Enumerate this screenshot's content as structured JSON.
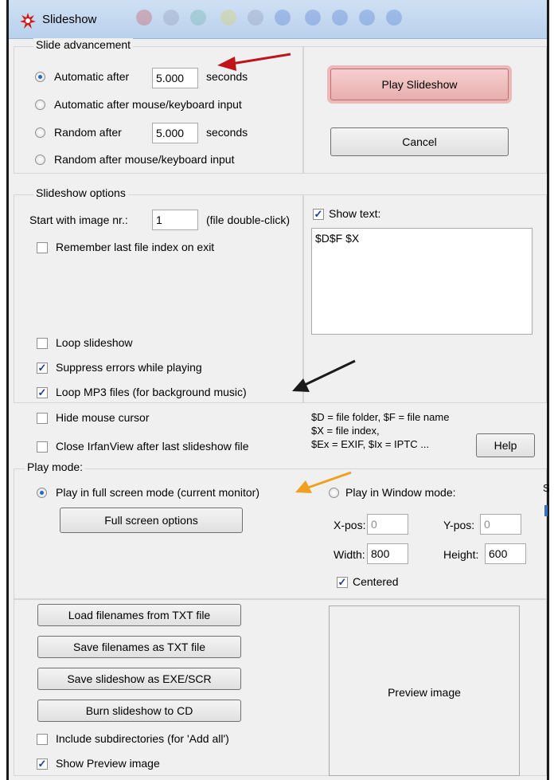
{
  "window": {
    "title": "Slideshow"
  },
  "advancement": {
    "label": "Slide advancement",
    "auto_after_label": "Automatic after",
    "auto_after_value": "5.000",
    "seconds_1": "seconds",
    "auto_input_label": "Automatic after mouse/keyboard input",
    "random_after_label": "Random  after",
    "random_after_value": "5.000",
    "seconds_2": "seconds",
    "random_input_label": "Random  after mouse/keyboard input",
    "selected": "Automatic after"
  },
  "actions": {
    "play_label": "Play Slideshow",
    "cancel_label": "Cancel"
  },
  "options": {
    "label": "Slideshow options",
    "start_label": "Start with image nr.:",
    "start_value": "1",
    "start_hint": "(file double-click)",
    "remember_label": "Remember last file index on exit",
    "remember_checked": false,
    "loop_label": "Loop slideshow",
    "loop_checked": false,
    "suppress_label": "Suppress errors while playing",
    "suppress_checked": true,
    "loop_mp3_label": "Loop MP3 files (for background music)",
    "loop_mp3_checked": true,
    "hide_cursor_label": "Hide mouse cursor",
    "hide_cursor_checked": false,
    "close_label": "Close IrfanView after last slideshow file",
    "close_checked": false,
    "show_text_label": "Show text:",
    "show_text_checked": true,
    "text_value": "$D$F $X",
    "legend_1": "$D = file folder, $F = file name",
    "legend_2": "$X = file index,",
    "legend_3": "$Ex = EXIF, $Ix = IPTC ...",
    "help_label": "Help"
  },
  "play_mode": {
    "label": "Play mode:",
    "fullscreen_label": "Play in full screen mode (current monitor)",
    "window_label": "Play in Window mode:",
    "selected": "fullscreen",
    "fs_options_label": "Full screen options",
    "xpos_label": "X-pos:",
    "xpos_value": "0",
    "ypos_label": "Y-pos:",
    "ypos_value": "0",
    "width_label": "Width:",
    "width_value": "800",
    "height_label": "Height:",
    "height_value": "600",
    "centered_label": "Centered",
    "centered_checked": true
  },
  "files": {
    "load_label": "Load filenames from TXT file",
    "save_label": "Save filenames as TXT file",
    "save_exe_label": "Save slideshow as  EXE/SCR",
    "burn_label": "Burn slideshow to CD",
    "subdirs_label": "Include subdirectories (for 'Add all')",
    "subdirs_checked": false,
    "show_preview_label": "Show Preview image",
    "show_preview_checked": true,
    "preview_label": "Preview image"
  },
  "edge_text": "S",
  "annotations": {
    "arrow_colors": [
      "#c0141c",
      "#1a1a1a",
      "#f0a020"
    ]
  }
}
